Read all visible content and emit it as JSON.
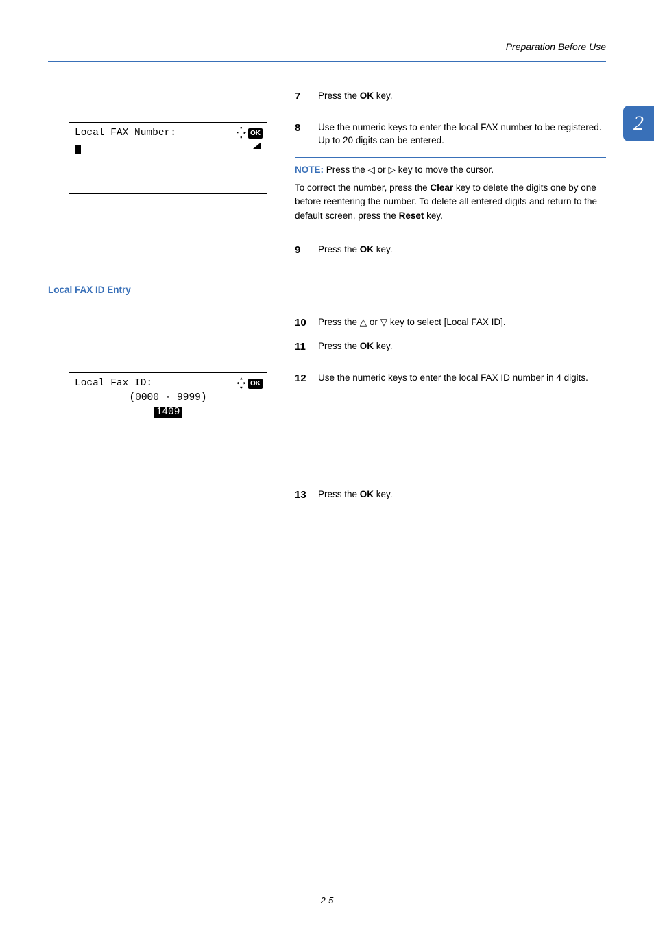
{
  "header": {
    "title": "Preparation Before Use"
  },
  "chapter_tab": "2",
  "lcd1": {
    "title": "Local FAX Number:",
    "ok": "OK"
  },
  "steps": {
    "s7": {
      "num": "7",
      "prefix": "Press the ",
      "bold": "OK",
      "suffix": " key."
    },
    "s8": {
      "num": "8",
      "text": "Use the numeric keys to enter the local FAX number to be registered. Up to 20 digits can be entered."
    },
    "s9": {
      "num": "9",
      "prefix": "Press the ",
      "bold": "OK",
      "suffix": " key."
    },
    "s10": {
      "num": "10",
      "prefix": "Press the ",
      "tri1": "△",
      "mid1": " or ",
      "tri2": "▽",
      "suffix": " key to select [Local FAX ID]."
    },
    "s11": {
      "num": "11",
      "prefix": "Press the ",
      "bold": "OK",
      "suffix": " key."
    },
    "s12": {
      "num": "12",
      "text": "Use the numeric keys to enter the local FAX ID number in 4 digits."
    },
    "s13": {
      "num": "13",
      "prefix": "Press the ",
      "bold": "OK",
      "suffix": " key."
    }
  },
  "note": {
    "label": "NOTE: ",
    "line1_prefix": "Press the ",
    "tri1": "◁",
    "mid": " or ",
    "tri2": "▷",
    "line1_suffix": " key to move the cursor.",
    "line2_a": "To correct the number, press the ",
    "line2_bold1": "Clear",
    "line2_b": " key to delete the digits one by one before reentering the number. To delete all entered digits and return to the default screen, press the ",
    "line2_bold2": "Reset",
    "line2_c": " key."
  },
  "section_heading": "Local FAX ID Entry",
  "lcd2": {
    "title": "Local Fax ID:",
    "range": "(0000 - 9999)",
    "pre": "   ",
    "value": " 1409 ",
    "ok": "OK"
  },
  "chart_data": {
    "type": "table",
    "title": "Local Fax ID numeric entry",
    "range_min": 0,
    "range_max": 9999,
    "current_value": 1409
  },
  "footer": {
    "page": "2-5"
  }
}
